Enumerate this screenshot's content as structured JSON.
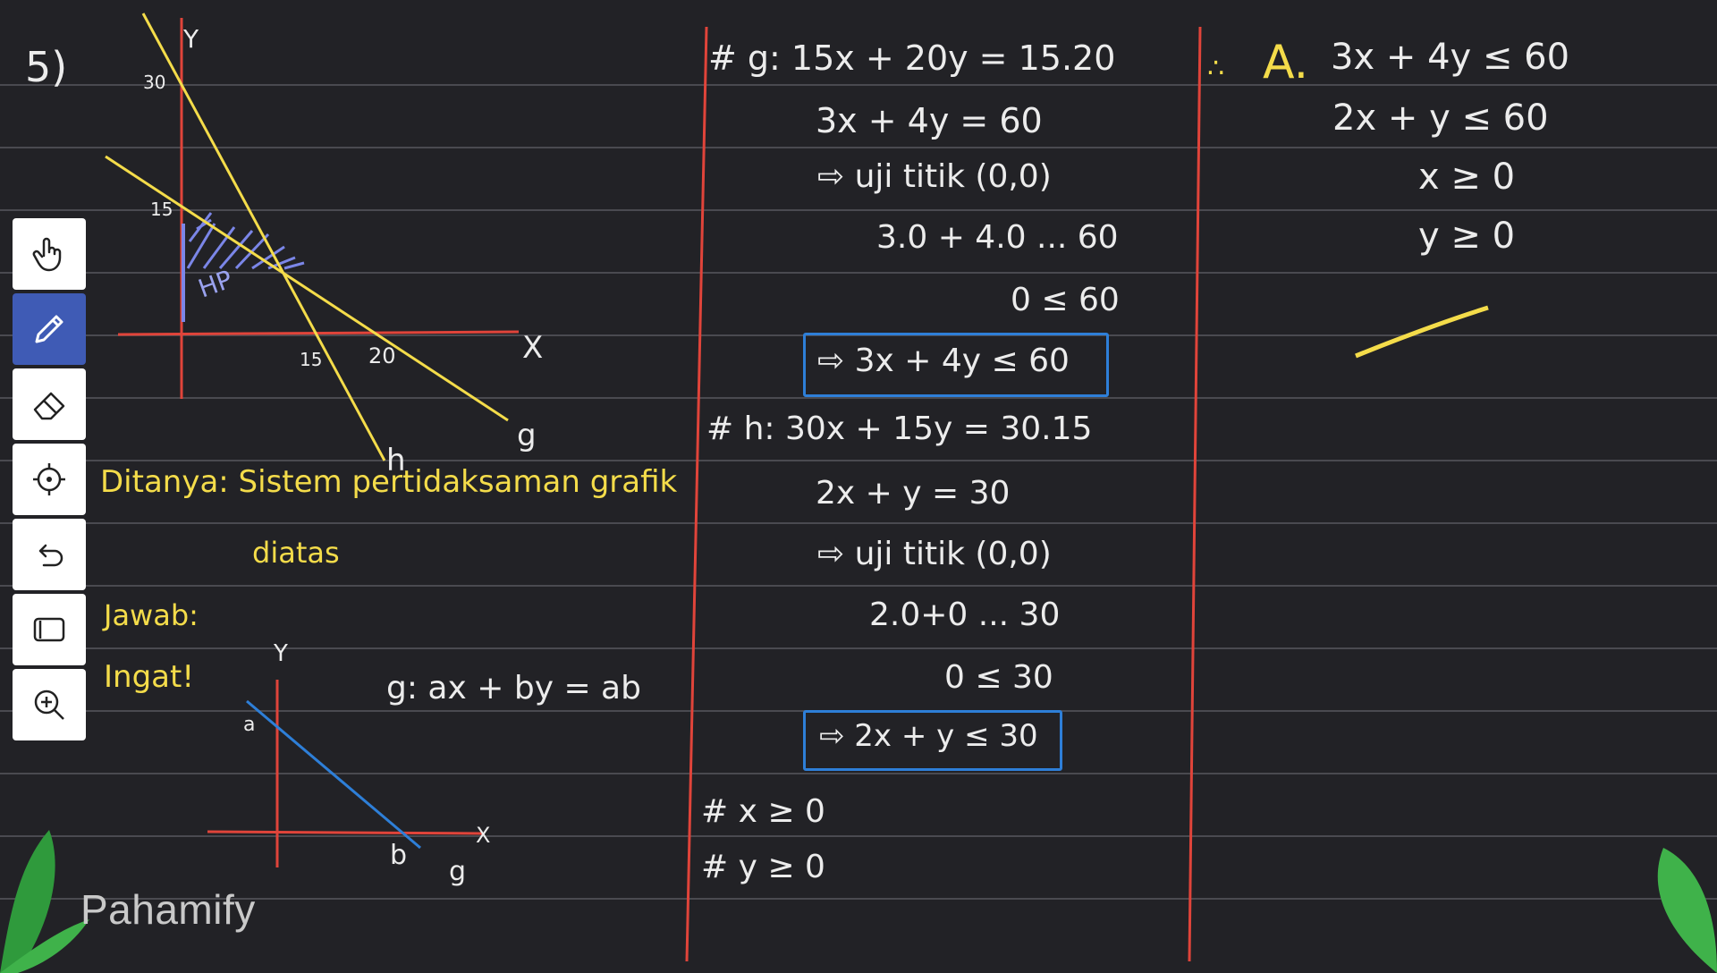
{
  "colors": {
    "background": "#222226",
    "white_ink": "#ececec",
    "yellow_ink": "#f4dc4a",
    "green_ink": "#7cf07a",
    "red_ink": "#e0443a",
    "blue_ink": "#2e7fd8",
    "toolbar_active": "#3f5bb5"
  },
  "toolbar": {
    "tools": [
      "hand-icon",
      "pen-icon",
      "eraser-icon",
      "laser-pointer-icon",
      "undo-icon",
      "shape-icon",
      "zoom-in-icon"
    ],
    "active_tool": "pen-icon"
  },
  "problem": {
    "number": "5)",
    "graph": {
      "x_label": "X",
      "y_label": "Y",
      "y_tick_30": "30",
      "y_tick_15": "15",
      "x_tick_15": "15",
      "x_tick_20": "20",
      "region_label": "HP",
      "line_g_label": "g",
      "line_h_label": "h"
    },
    "question_line1": "Ditanya: Sistem pertidaksaman grafik",
    "question_line2": "diatas",
    "answer_label": "Jawab:",
    "remember_label": "Ingat!",
    "mini_graph": {
      "y_label": "Y",
      "x_label": "X",
      "a_label": "a",
      "b_label": "b",
      "g_label": "g"
    },
    "formula": "g: ax + by = ab"
  },
  "work": {
    "g_line1": "# g: 15x + 20y = 15.20",
    "g_line2": "3x + 4y = 60",
    "g_line3": "⇨ uji titik (0,0)",
    "g_line4": "3.0 + 4.0 ... 60",
    "g_line5": "0 ≤ 60",
    "g_result": "⇨ 3x + 4y ≤ 60",
    "h_line1": "# h: 30x + 15y = 30.15",
    "h_line2": "2x + y = 30",
    "h_line3": "⇨ uji titik (0,0)",
    "h_line4": "2.0+0 ... 30",
    "h_line5": "0 ≤ 30",
    "h_result": "⇨ 2x + y ≤ 30",
    "x_cond": "# x ≥ 0",
    "y_cond": "# y ≥ 0"
  },
  "answer": {
    "prefix": "∴",
    "option": "A.",
    "ineq1": "3x + 4y ≤ 60",
    "ineq2": "2x + y ≤ 60",
    "ineq3": "x ≥ 0",
    "ineq4": "y ≥ 0"
  },
  "brand": "Pahamify"
}
